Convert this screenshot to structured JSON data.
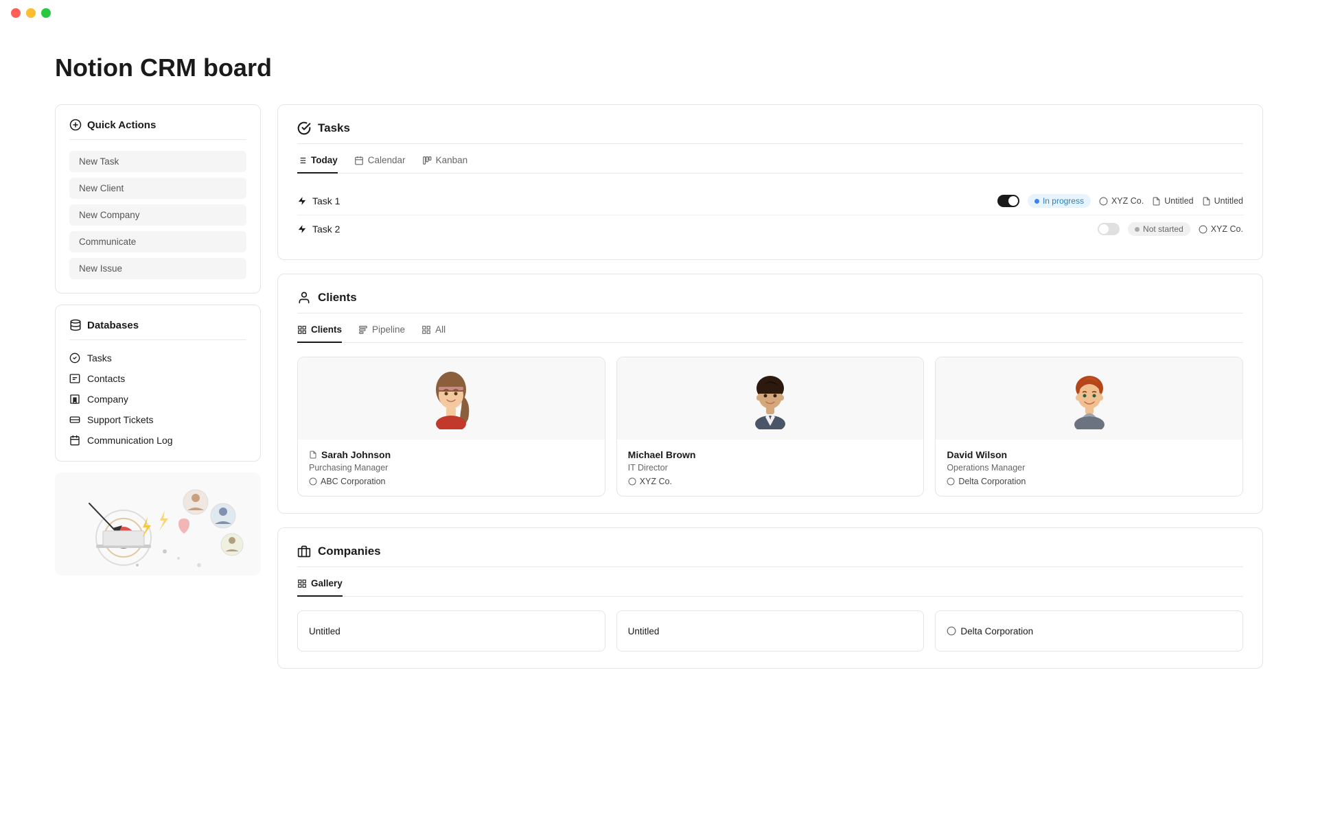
{
  "app": {
    "title": "Notion CRM board"
  },
  "traffic_lights": {
    "red": "#ff5f57",
    "yellow": "#febc2e",
    "green": "#28c840"
  },
  "quick_actions": {
    "title": "Quick Actions",
    "items": [
      {
        "label": "New Task"
      },
      {
        "label": "New Client"
      },
      {
        "label": "New Company"
      },
      {
        "label": "Communicate"
      },
      {
        "label": "New Issue"
      }
    ]
  },
  "databases": {
    "title": "Databases",
    "items": [
      {
        "label": "Tasks",
        "icon": "check-circle"
      },
      {
        "label": "Contacts",
        "icon": "contacts"
      },
      {
        "label": "Company",
        "icon": "building"
      },
      {
        "label": "Support Tickets",
        "icon": "ticket"
      },
      {
        "label": "Communication Log",
        "icon": "calendar"
      }
    ]
  },
  "tasks": {
    "section_title": "Tasks",
    "tabs": [
      {
        "label": "Today",
        "active": true
      },
      {
        "label": "Calendar"
      },
      {
        "label": "Kanban"
      }
    ],
    "rows": [
      {
        "name": "Task 1",
        "toggle_on": true,
        "status_label": "In progress",
        "status_type": "inprogress",
        "tags": [
          "XYZ Co.",
          "Untitled",
          "Untitled"
        ]
      },
      {
        "name": "Task 2",
        "toggle_on": false,
        "status_label": "Not started",
        "status_type": "notstarted",
        "tags": [
          "XYZ Co."
        ]
      }
    ]
  },
  "clients": {
    "section_title": "Clients",
    "tabs": [
      {
        "label": "Clients",
        "active": true
      },
      {
        "label": "Pipeline"
      },
      {
        "label": "All"
      }
    ],
    "cards": [
      {
        "name": "Sarah Johnson",
        "role": "Purchasing Manager",
        "company": "ABC Corporation",
        "avatar_color": "#e8d5c4"
      },
      {
        "name": "Michael Brown",
        "role": "IT Director",
        "company": "XYZ Co.",
        "avatar_color": "#d4c5b0"
      },
      {
        "name": "David Wilson",
        "role": "Operations Manager",
        "company": "Delta Corporation",
        "avatar_color": "#f0e0d0"
      }
    ]
  },
  "companies": {
    "section_title": "Companies",
    "tabs": [
      {
        "label": "Gallery",
        "active": true
      }
    ],
    "cards": [
      {
        "name": "Untitled",
        "has_icon": false
      },
      {
        "name": "Untitled",
        "has_icon": false
      },
      {
        "name": "Delta Corporation",
        "has_icon": true
      }
    ]
  }
}
